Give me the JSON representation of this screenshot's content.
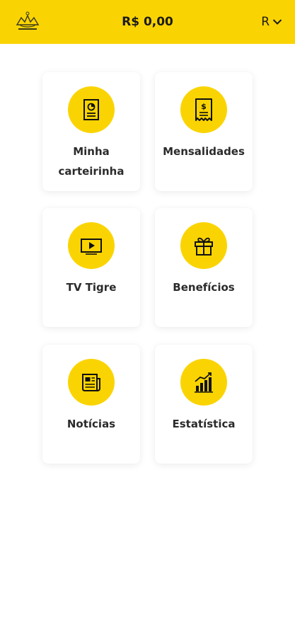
{
  "header": {
    "balance": "R$ 0,00",
    "user_initial": "R",
    "logo_icon": "club-crest-icon",
    "menu_icon": "chevron-down-icon",
    "background_color": "#FAD402"
  },
  "menu": [
    {
      "label": "Minha carteirinha",
      "icon": "member-card-icon"
    },
    {
      "label": "Mensalidades",
      "icon": "receipt-icon"
    },
    {
      "label": "TV Tigre",
      "icon": "play-video-icon"
    },
    {
      "label": "Benefícios",
      "icon": "gift-icon"
    },
    {
      "label": "Notícias",
      "icon": "newspaper-icon"
    },
    {
      "label": "Estatística",
      "icon": "statistics-chart-icon"
    }
  ],
  "colors": {
    "accent": "#FAD402",
    "icon_stroke": "#111111"
  }
}
